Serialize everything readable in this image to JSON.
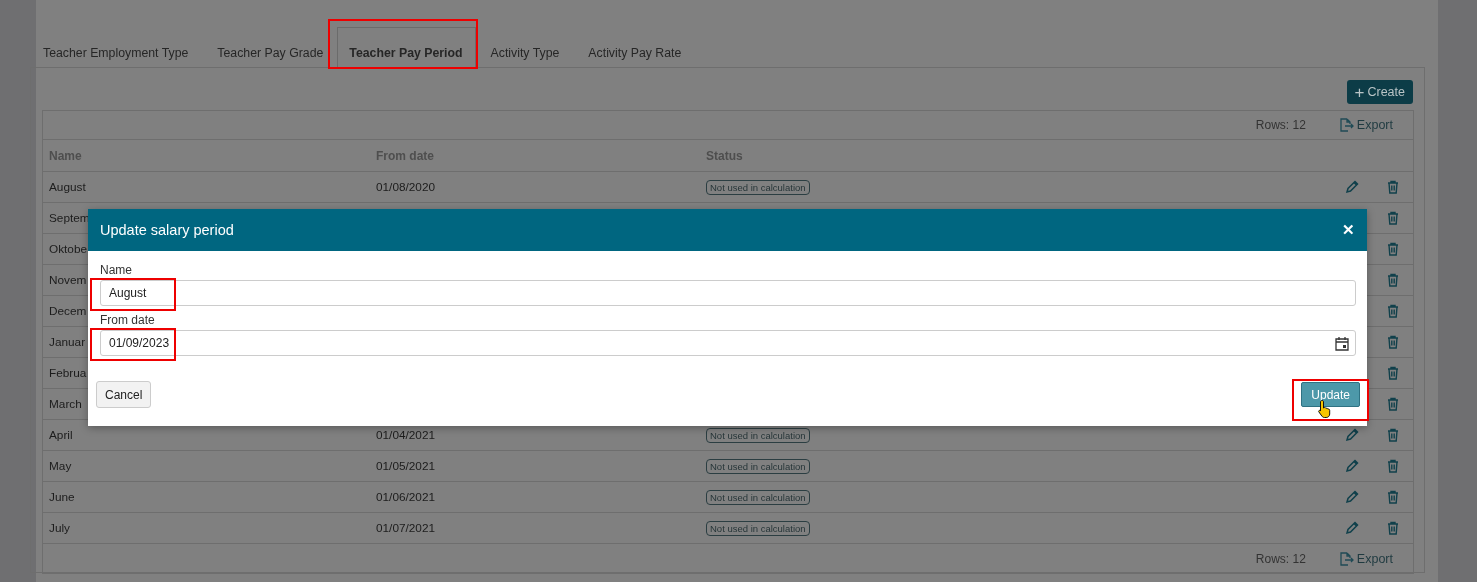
{
  "tabs": [
    {
      "label": "Teacher Employment Type",
      "selected": false,
      "highlighted": false
    },
    {
      "label": "Teacher Pay Grade",
      "selected": false,
      "highlighted": false
    },
    {
      "label": "Teacher Pay Period",
      "selected": true,
      "highlighted": true
    },
    {
      "label": "Activity Type",
      "selected": false,
      "highlighted": false
    },
    {
      "label": "Activity Pay Rate",
      "selected": false,
      "highlighted": false
    }
  ],
  "create_button": {
    "icon": "+",
    "label": "Create"
  },
  "toolbar": {
    "rows": "Rows: 12",
    "export": "Export"
  },
  "table": {
    "columns": [
      "Name",
      "From date",
      "Status"
    ],
    "rows": [
      {
        "kind": "full",
        "name": "August",
        "from_date": "01/08/2020",
        "status": "Not used in calculation"
      },
      {
        "kind": "covered",
        "name": "Septem"
      },
      {
        "kind": "covered",
        "name": "Oktobe"
      },
      {
        "kind": "covered",
        "name": "Novem"
      },
      {
        "kind": "covered",
        "name": "Decem"
      },
      {
        "kind": "covered",
        "name": "Januar"
      },
      {
        "kind": "covered",
        "name": "Februa"
      },
      {
        "kind": "covered",
        "name": "March"
      },
      {
        "kind": "full",
        "name": "April",
        "from_date": "01/04/2021",
        "status": "Not used in calculation"
      },
      {
        "kind": "full",
        "name": "May",
        "from_date": "01/05/2021",
        "status": "Not used in calculation"
      },
      {
        "kind": "full",
        "name": "June",
        "from_date": "01/06/2021",
        "status": "Not used in calculation"
      },
      {
        "kind": "full",
        "name": "July",
        "from_date": "01/07/2021",
        "status": "Not used in calculation"
      }
    ]
  },
  "footer": {
    "rows": "Rows: 12",
    "export": "Export"
  },
  "dialog": {
    "title": "Update salary period",
    "close": "✕",
    "fields": [
      {
        "kind": "text",
        "label": "Name",
        "value": "August",
        "highlighted": true
      },
      {
        "kind": "date",
        "label": "From date",
        "value": "01/09/2023",
        "highlighted": true
      }
    ],
    "cancel": "Cancel",
    "update": {
      "label": "Update",
      "highlighted": true
    }
  }
}
